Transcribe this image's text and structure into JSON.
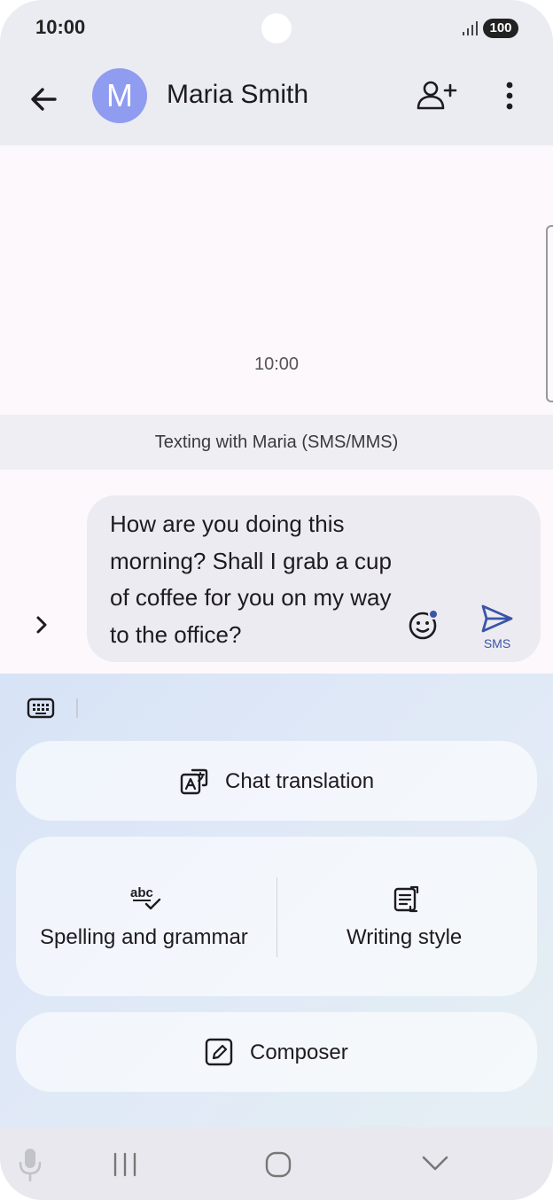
{
  "status": {
    "time": "10:00",
    "battery": "100"
  },
  "appbar": {
    "avatar_letter": "M",
    "contact_name": "Maria Smith"
  },
  "chat": {
    "timestamp": "10:00",
    "banner": "Texting with Maria (SMS/MMS)"
  },
  "composer": {
    "message": "How are you doing this morning? Shall I grab a cup of coffee for you on my way to the office?",
    "send_label": "SMS"
  },
  "assistant": {
    "chat_translation": "Chat translation",
    "spelling": "Spelling and grammar",
    "writing_style": "Writing style",
    "composer": "Composer"
  },
  "icons": [
    "back-arrow-icon",
    "add-person-icon",
    "more-vert-icon",
    "expand-chevron-icon",
    "emoji-icon",
    "send-icon",
    "keyboard-icon",
    "translate-icon",
    "spellcheck-icon",
    "writing-style-icon",
    "edit-icon",
    "mic-icon",
    "recents-icon",
    "home-icon",
    "hide-keyboard-icon"
  ],
  "colors": {
    "accent": "#3a55a8",
    "avatar": "#8f9cf0"
  }
}
